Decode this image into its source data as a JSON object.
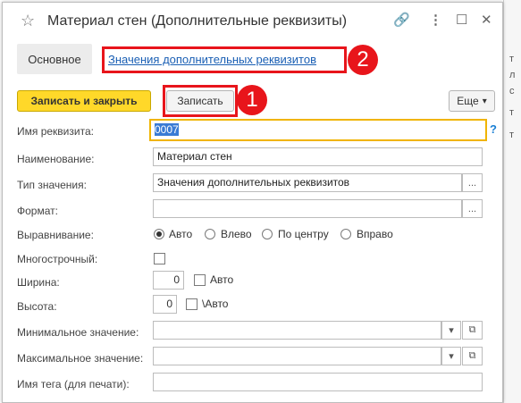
{
  "window": {
    "title": "Материал стен (Дополнительные реквизиты)",
    "icons": {
      "star": "☆",
      "link": "🔗",
      "menu": "⋮",
      "maximize": "☐",
      "close": "✕"
    }
  },
  "nav": {
    "main_tab": "Основное",
    "link_tab": "Значения дополнительных реквизитов"
  },
  "toolbar": {
    "save_close": "Записать и закрыть",
    "save": "Записать",
    "more": "Еще",
    "more_arrow": "▾"
  },
  "badges": {
    "one": "1",
    "two": "2"
  },
  "form": {
    "prop_name_label": "Имя реквизита:",
    "prop_name_value": "0007",
    "help_mark": "?",
    "name_label": "Наименование:",
    "name_value": "Материал стен",
    "type_label": "Тип значения:",
    "type_value": "Значения дополнительных реквизитов",
    "format_label": "Формат:",
    "format_value": "",
    "align_label": "Выравнивание:",
    "align_options": [
      "Авто",
      "Влево",
      "По центру",
      "Вправо"
    ],
    "align_selected": "Авто",
    "multiline_label": "Многострочный:",
    "width_label": "Ширина:",
    "width_value": "0",
    "width_auto": "Авто",
    "height_label": "Высота:",
    "height_value": "0",
    "height_auto": "\\Авто",
    "min_label": "Минимальное значение:",
    "max_label": "Максимальное значение:",
    "tag_label": "Имя тега (для печати):",
    "ellipsis": "...",
    "dropdown_arrow": "▾",
    "open_icon": "⧉"
  },
  "background": {
    "glyphs": [
      "т",
      "л",
      "с",
      "т",
      "т"
    ]
  }
}
